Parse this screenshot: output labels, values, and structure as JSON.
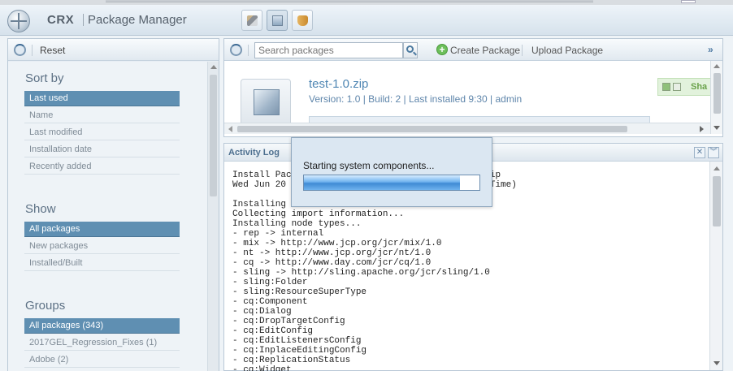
{
  "header": {
    "brand": "CRX",
    "title": "Package Manager"
  },
  "left_panel": {
    "reset_label": "Reset",
    "sort_by": {
      "heading": "Sort by",
      "items": [
        "Last used",
        "Name",
        "Last modified",
        "Installation date",
        "Recently added"
      ],
      "selected": "Last used"
    },
    "show": {
      "heading": "Show",
      "items": [
        "All packages",
        "New packages",
        "Installed/Built"
      ],
      "selected": "All packages"
    },
    "groups": {
      "heading": "Groups",
      "items": [
        "All packages (343)",
        "2017GEL_Regression_Fixes (1)",
        "Adobe (2)"
      ],
      "selected": "All packages (343)"
    }
  },
  "toolbar": {
    "search_placeholder": "Search packages",
    "create_label": "Create Package",
    "upload_label": "Upload Package",
    "more_icon": "»"
  },
  "package": {
    "name": "test-1.0.zip",
    "meta": "Version: 1.0 | Build: 2 | Last installed 9:30 | admin",
    "share_label": "Sha"
  },
  "activity_log": {
    "title": "Activity Log",
    "lines": [
      "Install Pac                                 .0.zip",
      "Wed Jun 20                                 dard Time)",
      "",
      "Installing",
      "Collecting import information...",
      "Installing node types...",
      "- rep -> internal",
      "- mix -> http://www.jcp.org/jcr/mix/1.0",
      "- nt -> http://www.jcp.org/jcr/nt/1.0",
      "- cq -> http://www.day.com/jcr/cq/1.0",
      "- sling -> http://sling.apache.org/jcr/sling/1.0",
      "- sling:Folder",
      "- sling:ResourceSuperType",
      "- cq:Component",
      "- cq:Dialog",
      "- cq:DropTargetConfig",
      "- cq:EditConfig",
      "- cq:EditListenersConfig",
      "- cq:InplaceEditingConfig",
      "- cq:ReplicationStatus",
      "- cq:Widget"
    ]
  },
  "modal": {
    "message": "Starting system components...",
    "progress": 0.89
  },
  "colors": {
    "accent": "#5f8fb2",
    "link": "#4f86b3"
  }
}
